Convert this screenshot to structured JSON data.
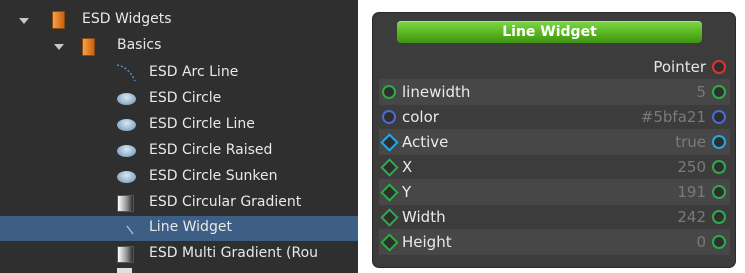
{
  "tree": {
    "items": [
      {
        "label": "ESD Widgets",
        "icon": "folder-icon"
      },
      {
        "label": "Basics",
        "icon": "folder-icon"
      },
      {
        "label": "ESD Arc Line",
        "icon": "arc-line-icon"
      },
      {
        "label": "ESD Circle",
        "icon": "circle-icon"
      },
      {
        "label": "ESD Circle Line",
        "icon": "circle-icon"
      },
      {
        "label": "ESD Circle Raised",
        "icon": "circle-icon"
      },
      {
        "label": "ESD Circle Sunken",
        "icon": "circle-icon"
      },
      {
        "label": "ESD Circular Gradient",
        "icon": "gradient-icon"
      },
      {
        "label": "Line Widget",
        "icon": "line-icon",
        "selected": true
      },
      {
        "label": "ESD Multi Gradient (Rou",
        "icon": "gradient-icon"
      }
    ]
  },
  "node": {
    "title": "Line Widget",
    "output_label": "Pointer",
    "properties": [
      {
        "name": "linewidth",
        "value": "5"
      },
      {
        "name": "color",
        "value": "#5bfa21"
      },
      {
        "name": "Active",
        "value": "true"
      },
      {
        "name": "X",
        "value": "250"
      },
      {
        "name": "Y",
        "value": "191"
      },
      {
        "name": "Width",
        "value": "242"
      },
      {
        "name": "Height",
        "value": "0"
      }
    ]
  },
  "colors": {
    "header_green": "#58b520",
    "selection": "#3e5f85",
    "port_green": "#2faa4a",
    "port_red": "#e03030",
    "port_blue": "#4a6ad8",
    "port_cyan": "#29a7e0"
  }
}
